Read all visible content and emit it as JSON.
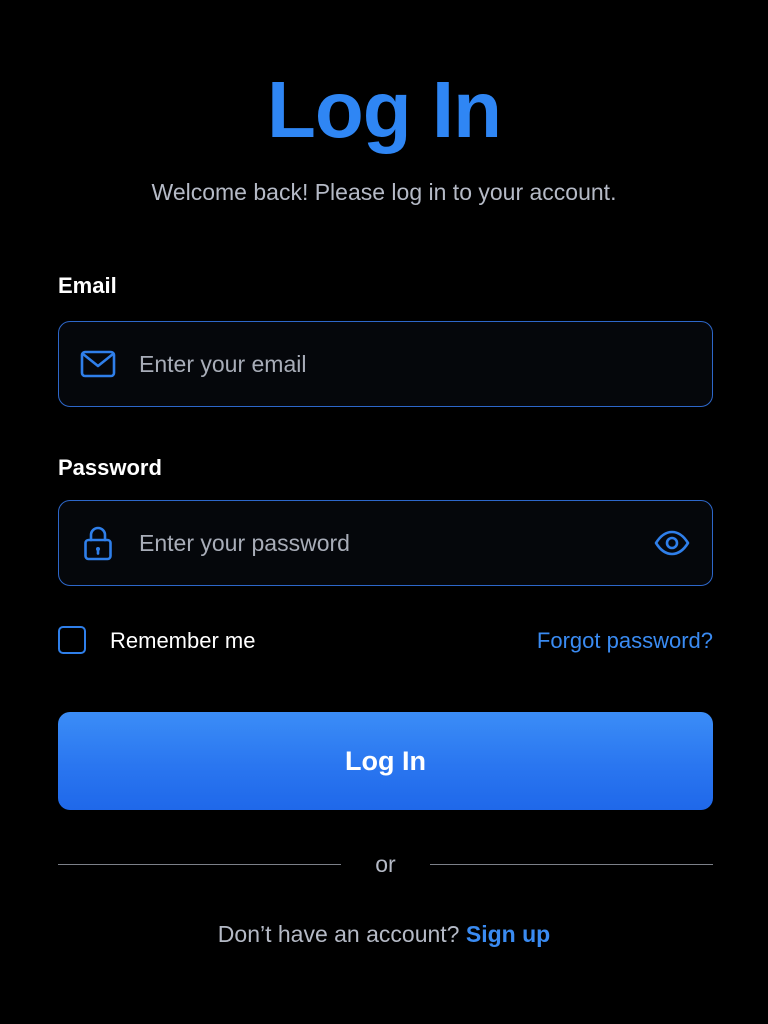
{
  "header": {
    "title": "Log In",
    "subtitle": "Welcome back! Please log in to your account."
  },
  "email": {
    "label": "Email",
    "placeholder": "Enter your email",
    "value": "",
    "icon": "mail-icon"
  },
  "password": {
    "label": "Password",
    "placeholder": "Enter your password",
    "value": "",
    "icon": "lock-icon",
    "toggle_icon": "eye-icon"
  },
  "options": {
    "remember_label": "Remember me",
    "remember_checked": false,
    "forgot_label": "Forgot password?"
  },
  "actions": {
    "login_label": "Log In",
    "divider_text": "or"
  },
  "signup": {
    "prompt": "Don’t have an account?",
    "link_label": "Sign up"
  },
  "colors": {
    "background": "#000000",
    "accent": "#2f86f4",
    "field_border": "#2d67c9",
    "muted_text": "#b5bac6"
  }
}
